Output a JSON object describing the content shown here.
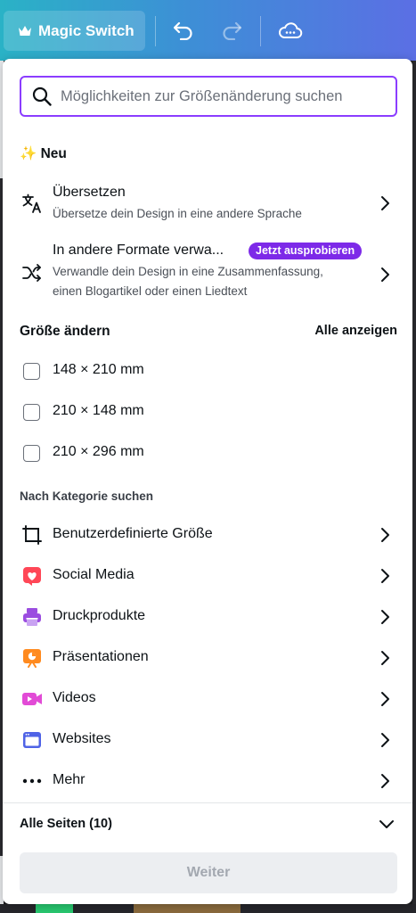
{
  "topbar": {
    "magic_switch_label": "Magic Switch"
  },
  "search": {
    "placeholder": "Möglichkeiten zur Größenänderung suchen",
    "value": ""
  },
  "new_section": {
    "title": "✨ Neu",
    "items": [
      {
        "title": "Übersetzen",
        "description": "Übersetze dein Design in eine andere Sprache",
        "icon": "translate-icon"
      },
      {
        "title": "In andere Formate verwa...",
        "badge": "Jetzt ausprobieren",
        "description_line1": "Verwandle dein Design in eine Zusammenfassung,",
        "description_line2": "einen Blogartikel oder einen Liedtext",
        "icon": "shuffle-icon"
      }
    ]
  },
  "resize_section": {
    "title": "Größe ändern",
    "see_all": "Alle anzeigen",
    "sizes": [
      "148 × 210 mm",
      "210 × 148 mm",
      "210 × 296 mm"
    ]
  },
  "category_section": {
    "title": "Nach Kategorie suchen",
    "items": [
      {
        "label": "Benutzerdefinierte Größe",
        "icon": "custom-size-icon"
      },
      {
        "label": "Social Media",
        "icon": "heart-icon",
        "color": "#ff4757"
      },
      {
        "label": "Druckprodukte",
        "icon": "printer-icon",
        "color": "#9b4de0"
      },
      {
        "label": "Präsentationen",
        "icon": "presentation-icon",
        "color": "#ff8a1f"
      },
      {
        "label": "Videos",
        "icon": "video-icon",
        "color": "#e24bd6"
      },
      {
        "label": "Websites",
        "icon": "website-icon",
        "color": "#4f63e6"
      },
      {
        "label": "Mehr",
        "icon": "more-dots-icon"
      }
    ]
  },
  "footer": {
    "pages_label": "Alle Seiten (10)",
    "continue_label": "Weiter"
  },
  "colors": {
    "accent": "#8b3dff",
    "badge": "#7d2ae8"
  }
}
